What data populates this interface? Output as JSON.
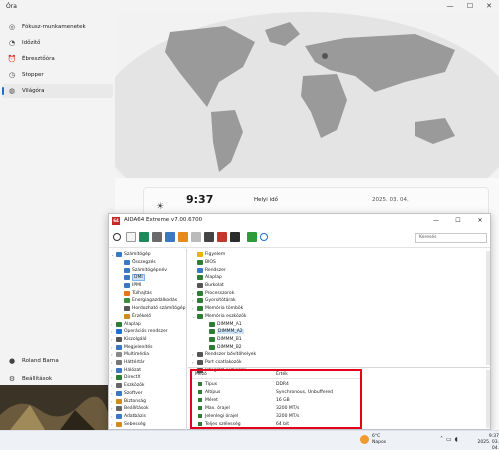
{
  "clock": {
    "title": "Óra",
    "nav": [
      {
        "icon": "focus-icon",
        "glyph": "◎",
        "label": "Fókusz-munkamenetek"
      },
      {
        "icon": "timer-icon",
        "glyph": "◔",
        "label": "Időzítő"
      },
      {
        "icon": "alarm-icon",
        "glyph": "⏰",
        "label": "Ébresztőóra"
      },
      {
        "icon": "stopwatch-icon",
        "glyph": "◷",
        "label": "Stopper"
      },
      {
        "icon": "globe-icon",
        "glyph": "◍",
        "label": "Világóra"
      }
    ],
    "user": "Roland Barna",
    "settings": "Beállítások",
    "card": {
      "time": "9:37",
      "label": "Helyi idő",
      "date": "2025. 03. 04."
    },
    "accent": "#1f6fd0"
  },
  "aida": {
    "title": "AIDA64 Extreme v7.00.6700",
    "logo": "64",
    "search_placeholder": "Keresés",
    "tree": [
      {
        "label": "Számítógép",
        "level": 1,
        "arrow": "v",
        "color": "#3b78c4"
      },
      {
        "label": "Összegzés",
        "level": 2,
        "arrow": "",
        "color": "#3b78c4"
      },
      {
        "label": "Számítógépnév",
        "level": 2,
        "arrow": "",
        "color": "#3b78c4"
      },
      {
        "label": "DMI",
        "level": 2,
        "arrow": "",
        "color": "#3b78c4",
        "selected": true
      },
      {
        "label": "IPMI",
        "level": 2,
        "arrow": "",
        "color": "#3b78c4"
      },
      {
        "label": "Túlhajtás",
        "level": 2,
        "arrow": "",
        "color": "#e0751c"
      },
      {
        "label": "Energiagazdálkodás",
        "level": 2,
        "arrow": "",
        "color": "#3a8f3a"
      },
      {
        "label": "Hordozható számítógép",
        "level": 2,
        "arrow": "",
        "color": "#555"
      },
      {
        "label": "Érzékelő",
        "level": 2,
        "arrow": "",
        "color": "#d08b1c"
      },
      {
        "label": "Alaplap",
        "level": 1,
        "arrow": ">",
        "color": "#2e7d32"
      },
      {
        "label": "Operációs rendszer",
        "level": 1,
        "arrow": ">",
        "color": "#1f6fd0"
      },
      {
        "label": "Kiszolgáló",
        "level": 1,
        "arrow": ">",
        "color": "#555"
      },
      {
        "label": "Megjelenítés",
        "level": 1,
        "arrow": ">",
        "color": "#3b78c4"
      },
      {
        "label": "Multimédia",
        "level": 1,
        "arrow": ">",
        "color": "#888"
      },
      {
        "label": "Háttértár",
        "level": 1,
        "arrow": ">",
        "color": "#777"
      },
      {
        "label": "Hálózat",
        "level": 1,
        "arrow": ">",
        "color": "#3b78c4"
      },
      {
        "label": "DirectX",
        "level": 1,
        "arrow": ">",
        "color": "#2e7d32"
      },
      {
        "label": "Eszközök",
        "level": 1,
        "arrow": ">",
        "color": "#666"
      },
      {
        "label": "Szoftver",
        "level": 1,
        "arrow": ">",
        "color": "#3b78c4"
      },
      {
        "label": "Biztonság",
        "level": 1,
        "arrow": ">",
        "color": "#d08b1c"
      },
      {
        "label": "Beállítások",
        "level": 1,
        "arrow": ">",
        "color": "#666"
      },
      {
        "label": "Adatbázis",
        "level": 1,
        "arrow": ">",
        "color": "#3b78c4"
      },
      {
        "label": "Sebesség",
        "level": 1,
        "arrow": ">",
        "color": "#d08b1c"
      }
    ],
    "content": [
      {
        "label": "Figyelem",
        "level": 1,
        "arrow": "",
        "color": "#e8b400"
      },
      {
        "label": "BIOS",
        "level": 1,
        "arrow": "",
        "color": "#2e7d32"
      },
      {
        "label": "Rendszer",
        "level": 1,
        "arrow": "",
        "color": "#3b78c4"
      },
      {
        "label": "Alaplap",
        "level": 1,
        "arrow": "",
        "color": "#2e7d32"
      },
      {
        "label": "Burkolat",
        "level": 1,
        "arrow": "",
        "color": "#555"
      },
      {
        "label": "Processzorok",
        "level": 1,
        "arrow": ">",
        "color": "#2e7d32"
      },
      {
        "label": "Gyorsítótárak",
        "level": 1,
        "arrow": ">",
        "color": "#2e7d32"
      },
      {
        "label": "Memória tömbök",
        "level": 1,
        "arrow": ">",
        "color": "#2e7d32"
      },
      {
        "label": "Memória eszközök",
        "level": 1,
        "arrow": "v",
        "color": "#2e7d32"
      },
      {
        "label": "DIMMM_A1",
        "level": 2,
        "arrow": "",
        "color": "#2e7d32"
      },
      {
        "label": "DIMMM_A2",
        "level": 2,
        "arrow": "",
        "color": "#2e7d32",
        "selected": true
      },
      {
        "label": "DIMMM_B1",
        "level": 2,
        "arrow": "",
        "color": "#2e7d32"
      },
      {
        "label": "DIMMM_B2",
        "level": 2,
        "arrow": "",
        "color": "#2e7d32"
      },
      {
        "label": "Rendszer bővítőhelyek",
        "level": 1,
        "arrow": ">",
        "color": "#555"
      },
      {
        "label": "Port csatlakozók",
        "level": 1,
        "arrow": ">",
        "color": "#555"
      },
      {
        "label": "Integrált eszközök",
        "level": 1,
        "arrow": ">",
        "color": "#555"
      }
    ],
    "props_header": {
      "field": "Mező",
      "value": "Érték"
    },
    "props": [
      {
        "field": "Típus",
        "value": "DDR4"
      },
      {
        "field": "Altípus",
        "value": "Synchronous, Unbuffered"
      },
      {
        "field": "Méret",
        "value": "16 GB"
      },
      {
        "field": "Max. órajel",
        "value": "3200 MT/s"
      },
      {
        "field": "Jelenlegi órajel",
        "value": "3200 MT/s"
      },
      {
        "field": "Teljes szélesség",
        "value": "64 bit"
      }
    ]
  },
  "taskbar": {
    "temp": "6°C",
    "weather": "Napos",
    "time": "9:37",
    "date": "2025. 03. 04."
  }
}
